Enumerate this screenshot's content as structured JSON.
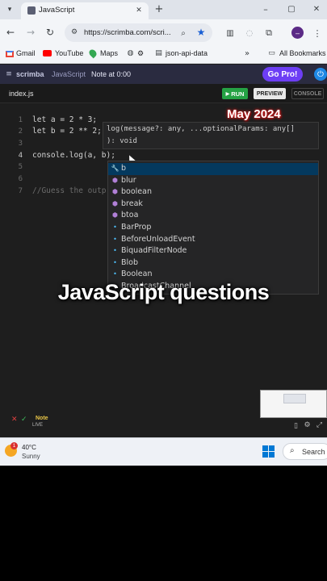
{
  "browser": {
    "tab_title": "JavaScript",
    "url": "https://scrimba.com/scri...",
    "bookmarks": [
      "Gmail",
      "YouTube",
      "Maps",
      "⚙",
      "json-api-data"
    ],
    "all_bookmarks": "All Bookmarks",
    "profile_letter": "–"
  },
  "scrimba": {
    "logo": "scrimba",
    "crumb": "JavaScript",
    "note": "Note at 0:00",
    "go_pro": "Go Pro!"
  },
  "editor": {
    "file_tab": "index.js",
    "run": "RUN",
    "preview": "PREVIEW",
    "console": "CONSOLE",
    "line_numbers": [
      "1",
      "2",
      "3",
      "4",
      "5",
      "6",
      "7"
    ],
    "lines": [
      "let a = 2 * 3;",
      "let b = 2 ** 2;",
      "",
      "console.log(a, b);",
      "",
      "",
      "//Guess the outp"
    ],
    "signature_hint": [
      "log(message?: any, ...optionalParams: any[]",
      "): void"
    ],
    "suggestions": [
      {
        "icon": "wrench",
        "text": "b"
      },
      {
        "icon": "cube",
        "text": "blur"
      },
      {
        "icon": "cube",
        "text": "boolean"
      },
      {
        "icon": "cube",
        "text": "break"
      },
      {
        "icon": "cube",
        "text": "btoa"
      },
      {
        "icon": "dots",
        "text": "BarProp"
      },
      {
        "icon": "dots",
        "text": "BeforeUnloadEvent"
      },
      {
        "icon": "dots",
        "text": "BiquadFilterNode"
      },
      {
        "icon": "dots",
        "text": "Blob"
      },
      {
        "icon": "dots",
        "text": "Boolean"
      },
      {
        "icon": "dots",
        "text": "BroadcastChannel"
      }
    ]
  },
  "overlay": {
    "title": "JavaScript questions",
    "date": "May 2024"
  },
  "bottom": {
    "note": "Note",
    "live": "LIVE"
  },
  "taskbar": {
    "temp": "40°C",
    "weather": "Sunny",
    "badge": "1",
    "search": "Search"
  },
  "colors": {
    "run_green": "#25a244",
    "go_pro": "#6d3ef5",
    "scrimba_bar": "#2a2b40",
    "editor_bg": "#1e1e1e"
  }
}
